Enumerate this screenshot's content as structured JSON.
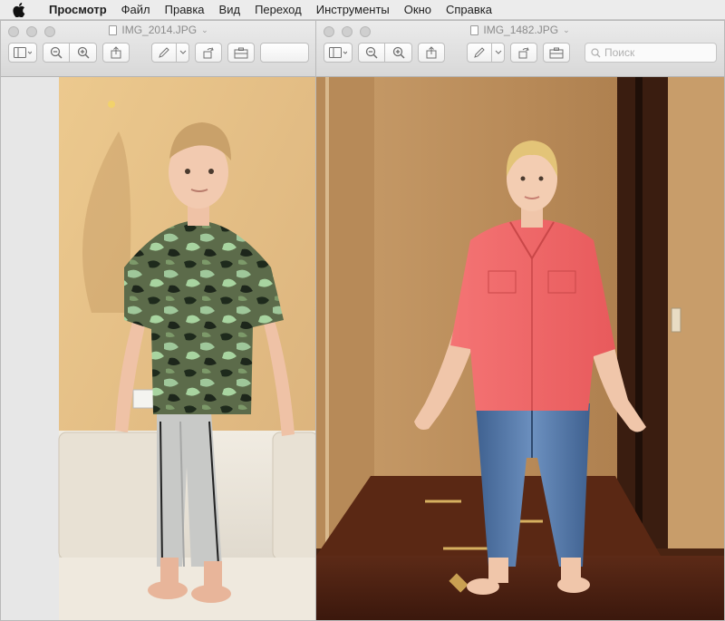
{
  "menubar": {
    "app_name": "Просмотр",
    "items": [
      "Файл",
      "Правка",
      "Вид",
      "Переход",
      "Инструменты",
      "Окно",
      "Справка"
    ]
  },
  "windows": [
    {
      "title": "IMG_2014.JPG",
      "toolbar_icons": [
        "sidebar-icon",
        "zoom-out-icon",
        "zoom-in-icon",
        "share-icon",
        "markup-icon",
        "rotate-icon",
        "toolbox-icon"
      ],
      "photo": "boy-in-camouflage-shirt"
    },
    {
      "title": "IMG_1482.JPG",
      "toolbar_icons": [
        "sidebar-icon",
        "zoom-out-icon",
        "zoom-in-icon",
        "share-icon",
        "markup-icon",
        "rotate-icon",
        "toolbox-icon"
      ],
      "search_placeholder": "Поиск",
      "photo": "woman-in-pink-shirt"
    }
  ],
  "colors": {
    "menubar_bg": "#ececec",
    "toolbar_bg": "#e2e2e2",
    "wall_left": "#e8c58e",
    "wall_right": "#c9a271",
    "shirt_pink": "#f16a6a",
    "jeans": "#4a6e9b"
  }
}
